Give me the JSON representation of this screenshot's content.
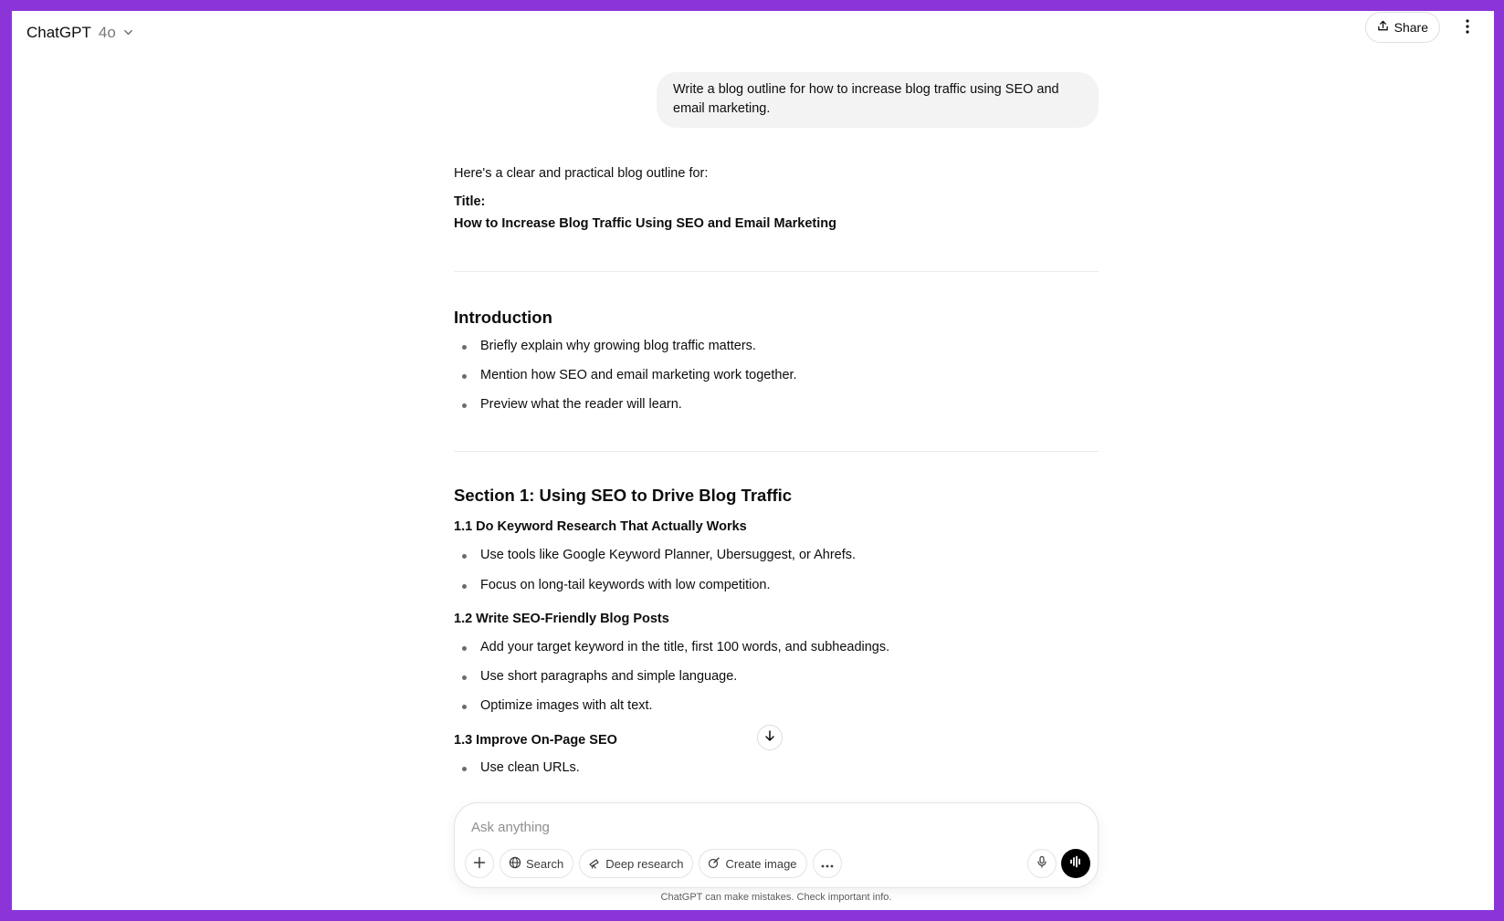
{
  "header": {
    "brand": "ChatGPT",
    "model": "4o",
    "share_label": "Share"
  },
  "user_message": "Write a blog outline for how to increase blog traffic using SEO and email marketing.",
  "assistant": {
    "intro": "Here's a clear and practical blog outline for:",
    "title_label": "Title:",
    "title_text": "How to Increase Blog Traffic Using SEO and Email Marketing",
    "introduction": {
      "heading": "Introduction",
      "bullets": [
        "Briefly explain why growing blog traffic matters.",
        "Mention how SEO and email marketing work together.",
        "Preview what the reader will learn."
      ]
    },
    "section1": {
      "heading": "Section 1: Using SEO to Drive Blog Traffic",
      "sub1": {
        "heading": "1.1 Do Keyword Research That Actually Works",
        "bullets": [
          "Use tools like Google Keyword Planner, Ubersuggest, or Ahrefs.",
          "Focus on long-tail keywords with low competition."
        ]
      },
      "sub2": {
        "heading": "1.2 Write SEO-Friendly Blog Posts",
        "bullets": [
          "Add your target keyword in the title, first 100 words, and subheadings.",
          "Use short paragraphs and simple language.",
          "Optimize images with alt text."
        ]
      },
      "sub3": {
        "heading": "1.3 Improve On-Page SEO",
        "bullets": [
          "Use clean URLs."
        ]
      }
    }
  },
  "composer": {
    "placeholder": "Ask anything",
    "tools": {
      "search": "Search",
      "deep_research": "Deep research",
      "create_image": "Create image"
    }
  },
  "disclaimer": "ChatGPT can make mistakes. Check important info.",
  "colors": {
    "frame_border": "#8b35d9",
    "user_bubble": "#f3f3f3",
    "voice_button": "#000000"
  }
}
